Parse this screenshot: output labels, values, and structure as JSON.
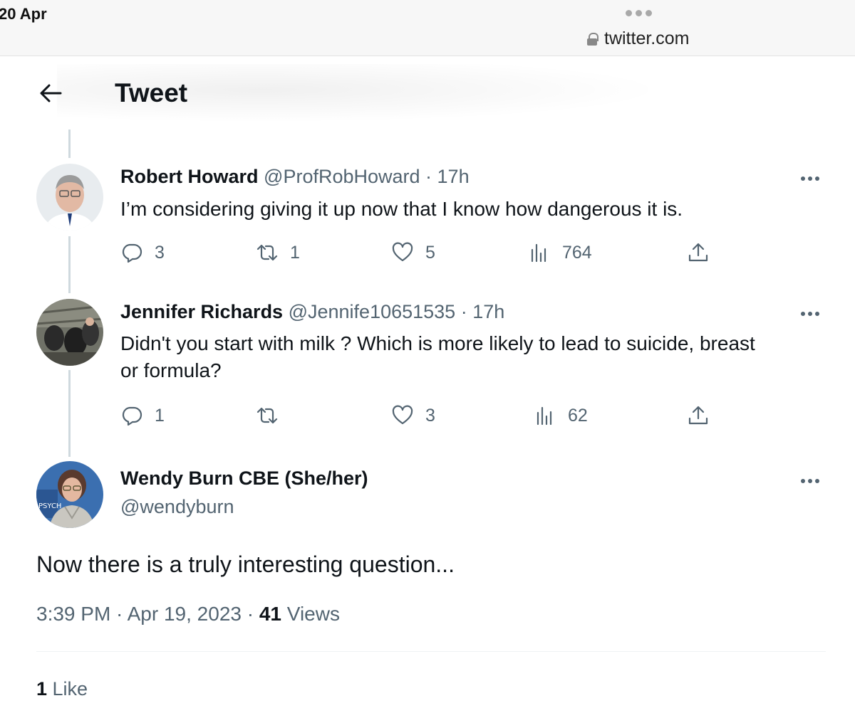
{
  "status": {
    "date": "20 Apr"
  },
  "browser": {
    "url": "twitter.com"
  },
  "header": {
    "title": "Tweet"
  },
  "replies": [
    {
      "name": "Robert Howard",
      "handle": "@ProfRobHoward",
      "time": "· 17h",
      "text": "I’m considering giving it up now that I know how dangerous it is.",
      "replies": "3",
      "retweets": "1",
      "likes": "5",
      "views": "764"
    },
    {
      "name": "Jennifer Richards",
      "handle": "@Jennife10651535",
      "time": "· 17h",
      "text_line1": "Didn't you start with milk ? Which is more likely to lead to suicide, breast",
      "text_line2": "or formula?",
      "replies": "1",
      "retweets": "",
      "likes": "3",
      "views": "62"
    }
  ],
  "main_tweet": {
    "name": "Wendy Burn CBE (She/her)",
    "handle": "@wendyburn",
    "text": "Now there is a truly interesting question...",
    "time": "3:39 PM · Apr 19, 2023 · ",
    "views_count": "41",
    "views_label": " Views",
    "likes_count": "1",
    "likes_label": " Like"
  },
  "icons": [
    "back-arrow-icon",
    "lock-icon",
    "more-icon",
    "reply-icon",
    "retweet-icon",
    "like-icon",
    "views-icon",
    "share-icon"
  ],
  "colors": {
    "text": "#0f1419",
    "secondary": "#536471",
    "thread_line": "#cfd9de"
  }
}
